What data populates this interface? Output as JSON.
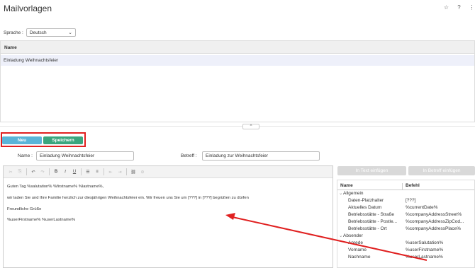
{
  "page": {
    "title": "Mailvorlagen"
  },
  "top_icons": [
    "star-icon",
    "help-icon",
    "more-icon"
  ],
  "language": {
    "label": "Sprache :",
    "value": "Deutsch"
  },
  "templates_grid": {
    "column": "Name",
    "rows": [
      "Einladung Weihnachtsfeier"
    ]
  },
  "actions": {
    "new_label": "Neu",
    "save_label": "Speichern"
  },
  "form": {
    "name_label": "Name :",
    "name_value": "Einladung Weihnachtsfeier",
    "subject_label": "Betreff :",
    "subject_value": "Einladung zur Weihnachtsfeier"
  },
  "editor": {
    "lines": [
      "Guten Tag %salutation% %firstname% %lastname%,",
      "wir laden Sie und Ihre Familie herzlich zur diesjährigen Weihnachtsfeier ein. Wir freuen uns Sie um [???] in [???] begrüßen zu dürfen",
      "Freundliche Grüße",
      "%userFirstname% %userLastname%"
    ]
  },
  "insert_buttons": {
    "text": "In Text einfügen",
    "subject": "In Betreff einfügen"
  },
  "placeholders": {
    "col_name": "Name",
    "col_command": "Befehl",
    "groups": [
      {
        "name": "Allgemein",
        "items": [
          {
            "name": "Daten-Platzhalter",
            "command": "[???]"
          },
          {
            "name": "Aktuelles Datum",
            "command": "%currentDate%"
          },
          {
            "name": "Betriebsstätte - Straße",
            "command": "%companyAddressStreet%"
          },
          {
            "name": "Betriebsstätte - Postle...",
            "command": "%companyAddressZipCod..."
          },
          {
            "name": "Betriebsstätte - Ort",
            "command": "%companyAddressPlace%"
          }
        ]
      },
      {
        "name": "Absender",
        "items": [
          {
            "name": "Anrede",
            "command": "%userSalutation%"
          },
          {
            "name": "Vorname",
            "command": "%userFirstname%"
          },
          {
            "name": "Nachname",
            "command": "%userLastname%"
          }
        ]
      }
    ]
  },
  "colors": {
    "new": "#5ab4d8",
    "save": "#3aa67e",
    "highlight": "#e02020"
  }
}
